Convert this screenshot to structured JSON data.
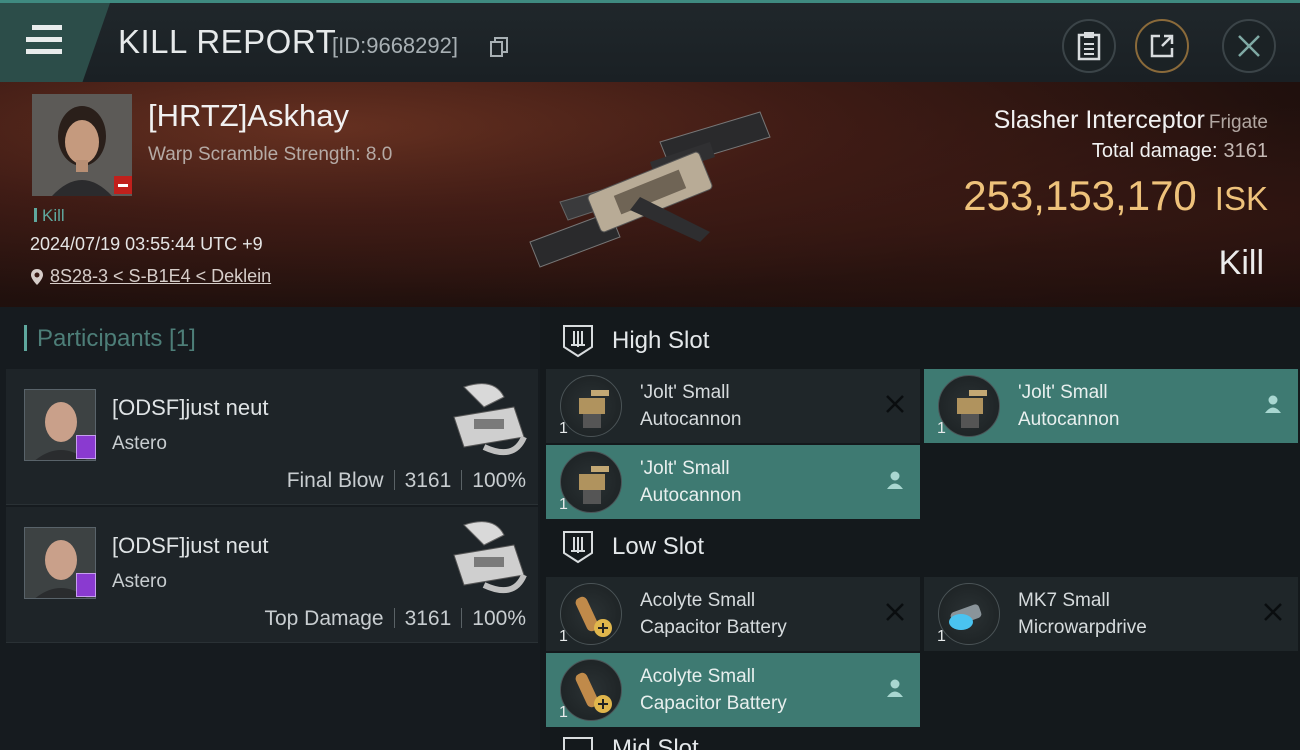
{
  "header": {
    "title": "KILL REPORT",
    "report_id": "[ID:9668292]",
    "menu_icon": "hamburger-icon",
    "buttons": [
      {
        "name": "clipboard-button",
        "icon": "clipboard-icon"
      },
      {
        "name": "share-button",
        "icon": "share-icon"
      },
      {
        "name": "close-button",
        "icon": "close-icon"
      }
    ]
  },
  "victim": {
    "pilot_name": "[HRTZ]Askhay",
    "subtitle": "Warp Scramble Strength: 8.0",
    "tag": "Kill",
    "datetime": "2024/07/19 03:55:44 UTC +9",
    "location": "8S28-3 < S-B1E4 < Deklein",
    "ship_name": "Slasher Interceptor",
    "ship_class": "Frigate",
    "total_damage_label": "Total damage:",
    "total_damage": "3161",
    "isk_value": "253,153,170",
    "isk_unit": "ISK",
    "result": "Kill"
  },
  "participants": {
    "header": "Participants [1]",
    "items": [
      {
        "name": "[ODSF]just neut",
        "ship": "Astero",
        "role": "Final Blow",
        "damage": "3161",
        "percent": "100%"
      },
      {
        "name": "[ODSF]just neut",
        "ship": "Astero",
        "role": "Top Damage",
        "damage": "3161",
        "percent": "100%"
      }
    ]
  },
  "slots": {
    "high": {
      "label": "High Slot",
      "modules": [
        {
          "line1": "'Jolt' Small",
          "line2": "Autocannon",
          "qty": "1",
          "state": "destroyed"
        },
        {
          "line1": "'Jolt' Small",
          "line2": "Autocannon",
          "qty": "1",
          "state": "dropped"
        },
        {
          "line1": "'Jolt' Small",
          "line2": "Autocannon",
          "qty": "1",
          "state": "dropped"
        }
      ]
    },
    "low": {
      "label": "Low Slot",
      "modules": [
        {
          "line1": "Acolyte Small",
          "line2": "Capacitor Battery",
          "qty": "1",
          "state": "destroyed"
        },
        {
          "line1": "MK7 Small",
          "line2": "Microwarpdrive",
          "qty": "1",
          "state": "destroyed"
        },
        {
          "line1": "Acolyte Small",
          "line2": "Capacitor Battery",
          "qty": "1",
          "state": "dropped"
        }
      ]
    },
    "next_label_partial": "Mid Slot"
  },
  "colors": {
    "accent_teal": "#3e7a72",
    "isk_gold": "#eec27b",
    "kill_red": "#c0201c"
  }
}
